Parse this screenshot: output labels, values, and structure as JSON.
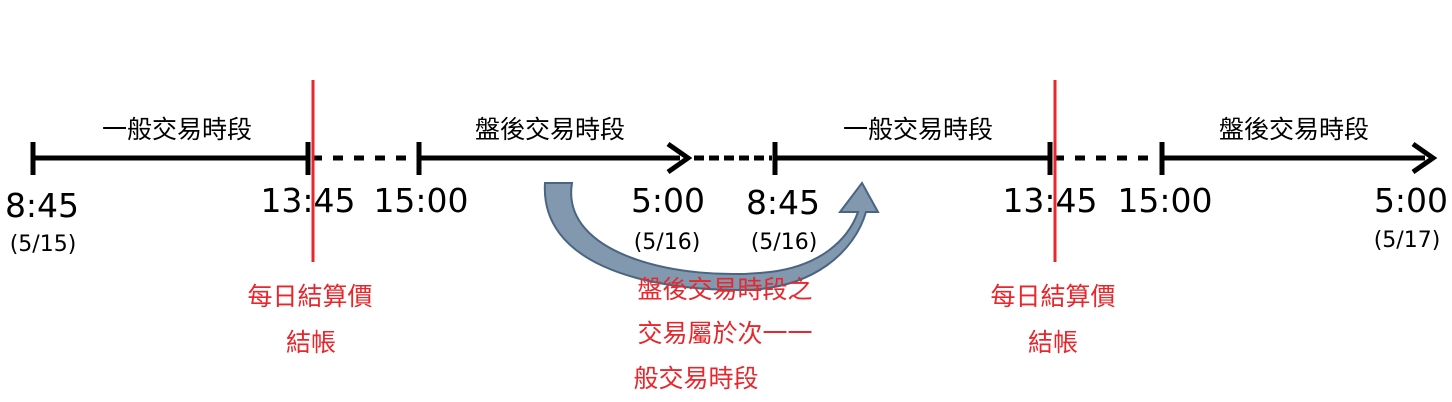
{
  "colors": {
    "timeline": "#000000",
    "settlement_line": "#e8262b",
    "note_text": "#e8262b",
    "arrow_fill": "#7a92ab",
    "arrow_stroke": "#4a6580"
  },
  "sessions": [
    "一般交易時段",
    "盤後交易時段",
    "一般交易時段",
    "盤後交易時段"
  ],
  "ticks": [
    {
      "time": "8:45",
      "date": "(5/15)"
    },
    {
      "time": "13:45",
      "date": ""
    },
    {
      "time": "15:00",
      "date": ""
    },
    {
      "time": "5:00",
      "date": "(5/16)"
    },
    {
      "time": "8:45",
      "date": "(5/16)"
    },
    {
      "time": "13:45",
      "date": ""
    },
    {
      "time": "15:00",
      "date": ""
    },
    {
      "time": "5:00",
      "date": "(5/17)"
    }
  ],
  "settlement_notes": [
    {
      "line1": "每日結算價",
      "line2": "結帳"
    },
    {
      "line1": "每日結算價",
      "line2": "結帳"
    }
  ],
  "carry_note": {
    "line1": "盤後交易時段之",
    "line2": "交易屬於次一一",
    "line3": "般交易時段"
  }
}
